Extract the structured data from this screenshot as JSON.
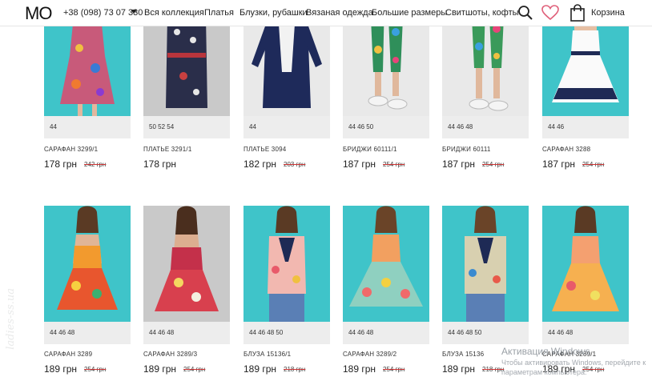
{
  "header": {
    "logo": "MO",
    "phone": "+38 (098) 73 07 330",
    "nav": [
      "Вся коллекция",
      "Платья",
      "Блузки, рубашки",
      "Вязаная одежда",
      "Большие размеры",
      "Свитшоты, кофты"
    ],
    "cart_label": "Корзина",
    "accent_color": "#e0607a"
  },
  "products_row1": [
    {
      "name": "САРАФАН 3299/1",
      "sizes": "44",
      "price": "178 грн",
      "old_price": "242 грн"
    },
    {
      "name": "ПЛАТЬЕ 3291/1",
      "sizes": "50  52  54",
      "price": "178 грн",
      "old_price": ""
    },
    {
      "name": "ПЛАТЬЕ 3094",
      "sizes": "44",
      "price": "182 грн",
      "old_price": "203 грн"
    },
    {
      "name": "БРИДЖИ 60111/1",
      "sizes": "44  46  50",
      "price": "187 грн",
      "old_price": "254 грн"
    },
    {
      "name": "БРИДЖИ 60111",
      "sizes": "44  46  48",
      "price": "187 грн",
      "old_price": "254 грн"
    },
    {
      "name": "САРАФАН 3288",
      "sizes": "44  46",
      "price": "187 грн",
      "old_price": "254 грн"
    }
  ],
  "products_row2": [
    {
      "name": "САРАФАН 3289",
      "sizes": "44  46  48",
      "price": "189 грн",
      "old_price": "254 грн"
    },
    {
      "name": "САРАФАН 3289/3",
      "sizes": "44  46  48",
      "price": "189 грн",
      "old_price": "254 грн"
    },
    {
      "name": "БЛУЗА 15136/1",
      "sizes": "44  46  48  50",
      "price": "189 грн",
      "old_price": "218 грн"
    },
    {
      "name": "САРАФАН 3289/2",
      "sizes": "44  46  48",
      "price": "189 грн",
      "old_price": "254 грн"
    },
    {
      "name": "БЛУЗА 15136",
      "sizes": "44  46  48  50",
      "price": "189 грн",
      "old_price": "218 грн"
    },
    {
      "name": "САРАФАН 3289/1",
      "sizes": "44  46  48",
      "price": "189 грн",
      "old_price": "254 грн"
    }
  ],
  "overlay": {
    "activation_title": "Активация Windows",
    "activation_text": "Чтобы активировать Windows, перейдите к параметрам компьютера.",
    "side_watermark": "ladies-ss.ua"
  },
  "colors": {
    "photo_teal": "#3fc4c9",
    "sizes_bar": "#ededed",
    "strike": "#c33333"
  }
}
